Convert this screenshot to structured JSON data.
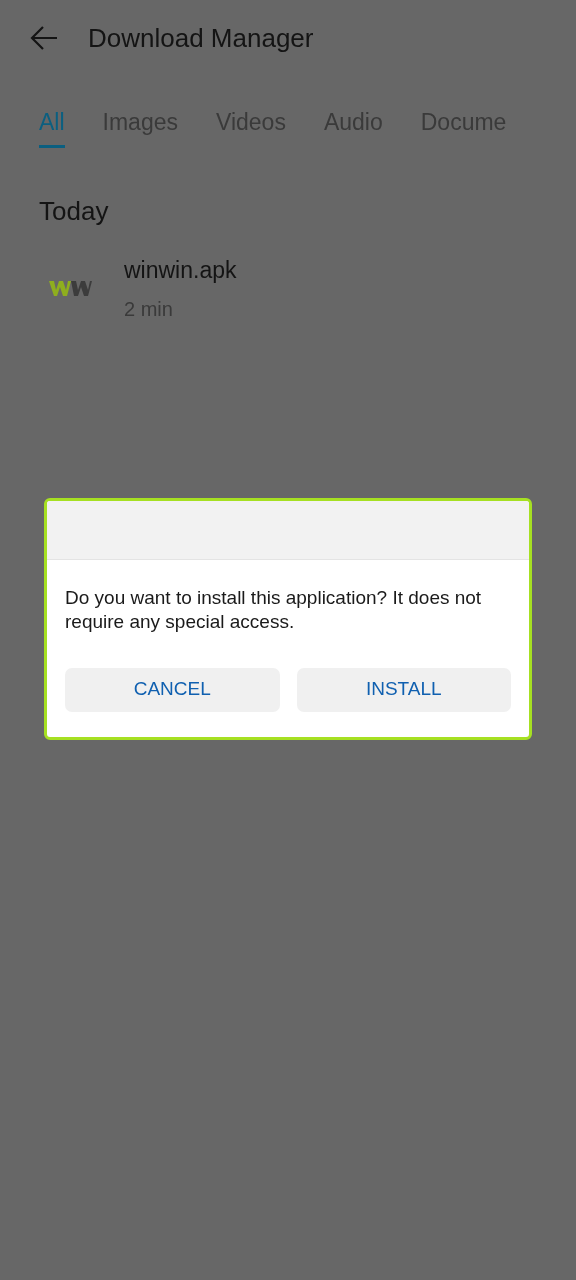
{
  "header": {
    "title": "Download Manager"
  },
  "tabs": [
    {
      "label": "All",
      "selected": true
    },
    {
      "label": "Images",
      "selected": false
    },
    {
      "label": "Videos",
      "selected": false
    },
    {
      "label": "Audio",
      "selected": false
    },
    {
      "label": "Docume",
      "selected": false
    }
  ],
  "sections": [
    {
      "title": "Today",
      "items": [
        {
          "name": "winwin.apk",
          "time": "2 min"
        }
      ]
    }
  ],
  "dialog": {
    "message": "Do you want to install this application? It does not require any special access.",
    "buttons": [
      "CANCEL",
      "INSTALL"
    ]
  }
}
